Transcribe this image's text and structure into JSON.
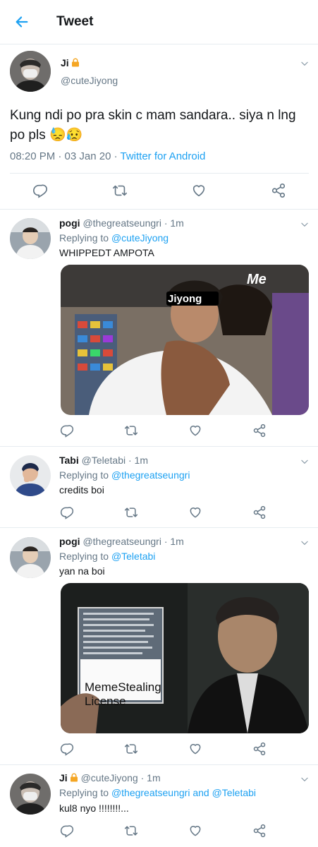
{
  "header": {
    "title": "Tweet"
  },
  "main_tweet": {
    "name": "Ji",
    "handle": "@cuteJiyong",
    "text": "Kung ndi po pra skin c mam sandara.. siya n lng po pls 😓😥",
    "time": "08:20 PM · 03 Jan 20 ·",
    "source": "Twitter for Android"
  },
  "replies": [
    {
      "name": "pogi",
      "handle": "@thegreatseungri",
      "age": "· 1m",
      "replying_label": "Replying to",
      "replying_to": "@cuteJiyong",
      "text": "WHIPPEDT AMPOTA",
      "media_labels": [
        "Jiyong",
        "Me"
      ]
    },
    {
      "name": "Tabi",
      "handle": "@Teletabi",
      "age": "· 1m",
      "replying_label": "Replying to",
      "replying_to": "@thegreatseungri",
      "text": "credits boi"
    },
    {
      "name": "pogi",
      "handle": "@thegreatseungri",
      "age": "· 1m",
      "replying_label": "Replying to",
      "replying_to": "@Teletabi",
      "text": "yan na boi",
      "media_labels": [
        "MemeStealing",
        "License"
      ]
    },
    {
      "name": "Ji",
      "handle": "@cuteJiyong",
      "age": "· 1m",
      "replying_label": "Replying to",
      "replying_to": "@thegreatseungri and @Teletabi",
      "text": "kul8 nyo !!!!!!!!..."
    }
  ],
  "colors": {
    "accent": "#1da1f2",
    "muted": "#657786",
    "divider": "#e6ecf0"
  }
}
